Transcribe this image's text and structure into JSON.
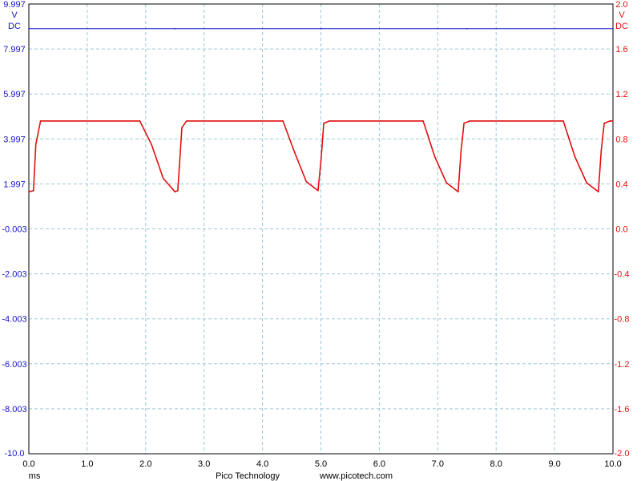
{
  "chart_data": {
    "type": "line",
    "grid": true,
    "x_unit": "ms",
    "xlim": [
      0.0,
      10.0
    ],
    "x_ticks": [
      "0.0",
      "1.0",
      "2.0",
      "3.0",
      "4.0",
      "5.0",
      "6.0",
      "7.0",
      "8.0",
      "9.0",
      "10.0"
    ],
    "left_axis": {
      "ylim": [
        -10.0,
        9.997
      ],
      "unit": "V",
      "coupling": "DC",
      "ticks": [
        "9.997",
        "7.997",
        "5.997",
        "3.997",
        "1.997",
        "-0.003",
        "-2.003",
        "-4.003",
        "-6.003",
        "-8.003",
        "-10.0"
      ],
      "color": "#1414c8"
    },
    "right_axis": {
      "ylim": [
        -2.0,
        2.0
      ],
      "unit": "V",
      "coupling": "DC",
      "ticks": [
        "2.0",
        "1.6",
        "1.2",
        "0.8",
        "0.4",
        "0.0",
        "-0.4",
        "-0.8",
        "-1.2",
        "-1.6",
        "-2.0"
      ],
      "color": "#e01010"
    },
    "series": [
      {
        "axis": "left",
        "color": "#1414c8",
        "x": [
          0.0,
          2.5,
          5.0,
          7.5,
          10.0
        ],
        "y": [
          8.9,
          8.9,
          8.9,
          8.9,
          8.9
        ]
      },
      {
        "axis": "right",
        "color": "#e01010",
        "x": [
          0.0,
          0.08,
          0.12,
          0.2,
          1.9,
          2.1,
          2.3,
          2.5,
          2.55,
          2.62,
          2.7,
          4.35,
          4.55,
          4.75,
          4.95,
          5.0,
          5.05,
          5.15,
          6.75,
          6.95,
          7.15,
          7.35,
          7.4,
          7.45,
          7.55,
          9.15,
          9.35,
          9.55,
          9.75,
          9.8,
          9.85,
          9.95,
          10.0
        ],
        "y": [
          0.33,
          0.34,
          0.75,
          0.96,
          0.96,
          0.75,
          0.45,
          0.33,
          0.34,
          0.9,
          0.96,
          0.96,
          0.68,
          0.42,
          0.34,
          0.6,
          0.94,
          0.96,
          0.96,
          0.64,
          0.41,
          0.33,
          0.7,
          0.94,
          0.96,
          0.96,
          0.64,
          0.41,
          0.33,
          0.7,
          0.94,
          0.96,
          0.96
        ]
      }
    ]
  },
  "footer": {
    "x_unit_label": "ms",
    "brand": "Pico Technology",
    "website": "www.picotech.com"
  }
}
